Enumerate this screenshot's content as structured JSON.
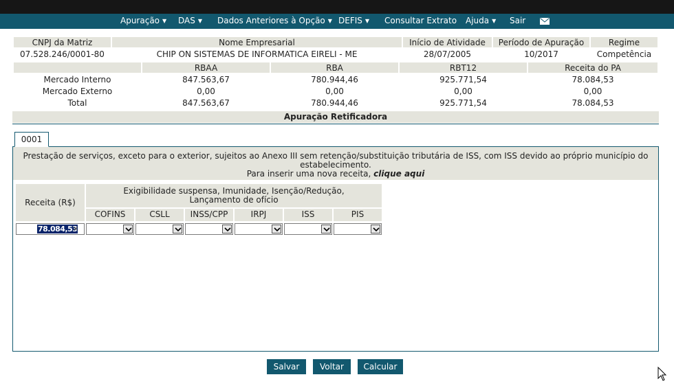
{
  "nav": {
    "items": [
      {
        "label": "Apuração",
        "caret": "▼"
      },
      {
        "label": "DAS",
        "caret": "▼"
      },
      {
        "label": "Dados Anteriores à Opção",
        "caret": "▼"
      },
      {
        "label": "DEFIS",
        "caret": "▼"
      },
      {
        "label": "Consultar Extrato",
        "caret": ""
      },
      {
        "label": "Ajuda",
        "caret": "▼"
      },
      {
        "label": "Sair",
        "caret": ""
      }
    ],
    "mail_icon": "envelope-icon"
  },
  "company": {
    "headers": [
      "CNPJ da Matriz",
      "Nome Empresarial",
      "Início de Atividade",
      "Período de Apuração",
      "Regime"
    ],
    "values": [
      "07.528.246/0001-80",
      "CHIP ON SISTEMAS DE INFORMATICA EIRELI - ME",
      "28/07/2005",
      "10/2017",
      "Competência"
    ]
  },
  "revenue_table": {
    "headers": [
      "RBAA",
      "RBA",
      "RBT12",
      "Receita do PA"
    ],
    "rows": [
      {
        "label": "Mercado Interno",
        "values": [
          "847.563,67",
          "780.944,46",
          "925.771,54",
          "78.084,53"
        ]
      },
      {
        "label": "Mercado Externo",
        "values": [
          "0,00",
          "0,00",
          "0,00",
          "0,00"
        ]
      },
      {
        "label": "Total",
        "values": [
          "847.563,67",
          "780.944,46",
          "925.771,54",
          "78.084,53"
        ]
      }
    ]
  },
  "section_title": "Apuração Retificadora",
  "tab": {
    "label": "0001"
  },
  "activity": {
    "description_line1": "Prestação de serviços, exceto para o exterior, sujeitos ao Anexo III sem retenção/substituição tributária de ISS, com ISS devido ao próprio município do",
    "description_line2": "estabelecimento.",
    "insert_prefix": "Para inserir uma nova receita, ",
    "insert_link": "clique aqui"
  },
  "form": {
    "receita_header": "Receita (R$)",
    "group_header_line1": "Exigibilidade suspensa, Imunidade, Isenção/Redução,",
    "group_header_line2": "Lançamento de ofício",
    "tax_columns": [
      "COFINS",
      "CSLL",
      "INSS/CPP",
      "IRPJ",
      "ISS",
      "PIS"
    ],
    "receita_value": "78.084,53",
    "clear_symbol": "×"
  },
  "buttons": {
    "save": "Salvar",
    "back": "Voltar",
    "calc": "Calcular"
  },
  "colors": {
    "primary": "#12586e",
    "header_bg": "#e4e4dc",
    "topbar": "#161616"
  }
}
